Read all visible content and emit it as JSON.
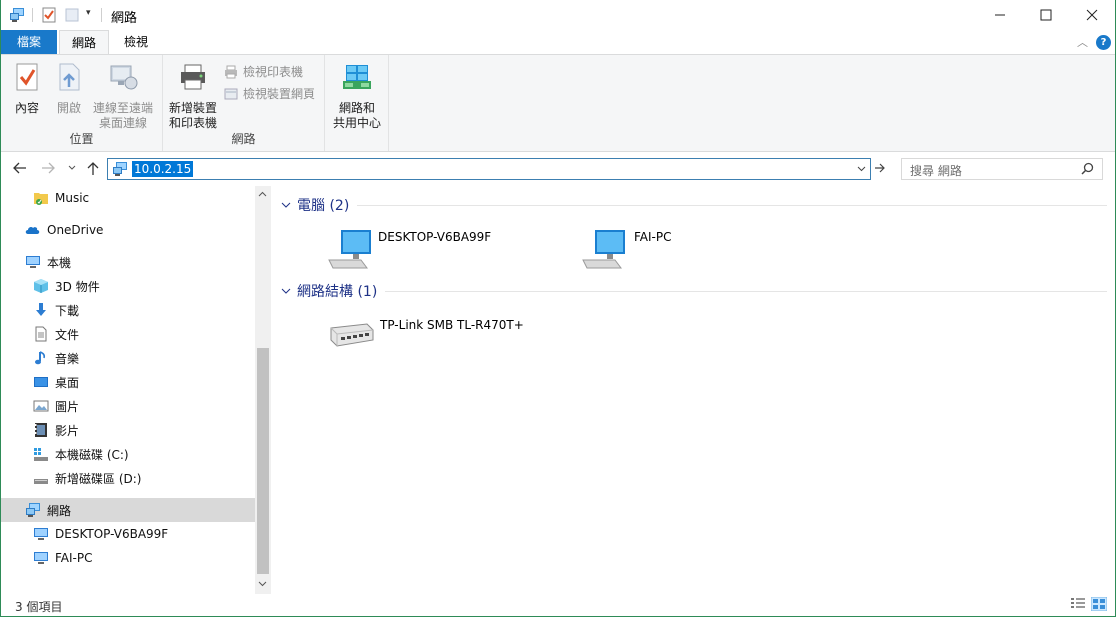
{
  "window": {
    "title": "網路",
    "quick_access": [
      "properties-icon",
      "new-folder-icon",
      "customize-dropdown-icon"
    ]
  },
  "ribbon_tabs": {
    "file": "檔案",
    "network": "網路",
    "view": "檢視"
  },
  "ribbon": {
    "location_group": {
      "label": "位置",
      "properties": "內容",
      "open": "開啟",
      "remote_desktop_line1": "連線至遠端",
      "remote_desktop_line2": "桌面連線"
    },
    "network_group": {
      "label": "網路",
      "add_devices_line1": "新增裝置",
      "add_devices_line2": "和印表機",
      "view_printers": "檢視印表機",
      "view_device_webpage": "檢視裝置網頁"
    },
    "center_group": {
      "network_center_line1": "網路和",
      "network_center_line2": "共用中心"
    }
  },
  "address_bar": {
    "path": "10.0.2.15",
    "search_placeholder": "搜尋 網路"
  },
  "sidebar": {
    "items": [
      {
        "label": "Music",
        "icon": "music-folder-icon"
      },
      {
        "label": "OneDrive",
        "icon": "onedrive-icon"
      },
      {
        "label": "本機",
        "icon": "this-pc-icon"
      },
      {
        "label": "3D 物件",
        "icon": "3d-objects-icon"
      },
      {
        "label": "下載",
        "icon": "downloads-icon"
      },
      {
        "label": "文件",
        "icon": "documents-icon"
      },
      {
        "label": "音樂",
        "icon": "music-icon"
      },
      {
        "label": "桌面",
        "icon": "desktop-icon"
      },
      {
        "label": "圖片",
        "icon": "pictures-icon"
      },
      {
        "label": "影片",
        "icon": "videos-icon"
      },
      {
        "label": "本機磁碟 (C:)",
        "icon": "local-disk-icon"
      },
      {
        "label": "新增磁碟區 (D:)",
        "icon": "volume-icon"
      },
      {
        "label": "網路",
        "icon": "network-icon"
      },
      {
        "label": "DESKTOP-V6BA99F",
        "icon": "computer-icon"
      },
      {
        "label": "FAI-PC",
        "icon": "computer-icon"
      }
    ]
  },
  "content": {
    "groups": [
      {
        "title": "電腦 (2)",
        "items": [
          {
            "label": "DESKTOP-V6BA99F",
            "icon": "computer-icon"
          },
          {
            "label": "FAI-PC",
            "icon": "computer-icon"
          }
        ]
      },
      {
        "title": "網路結構 (1)",
        "items": [
          {
            "label": "TP-Link SMB TL-R470T+",
            "icon": "router-icon"
          }
        ]
      }
    ]
  },
  "statusbar": {
    "item_count": "3 個項目"
  },
  "colors": {
    "accent": "#1979ca",
    "selection": "#0078d7",
    "group_header": "#1e3287",
    "window_border": "#2e8b57"
  }
}
